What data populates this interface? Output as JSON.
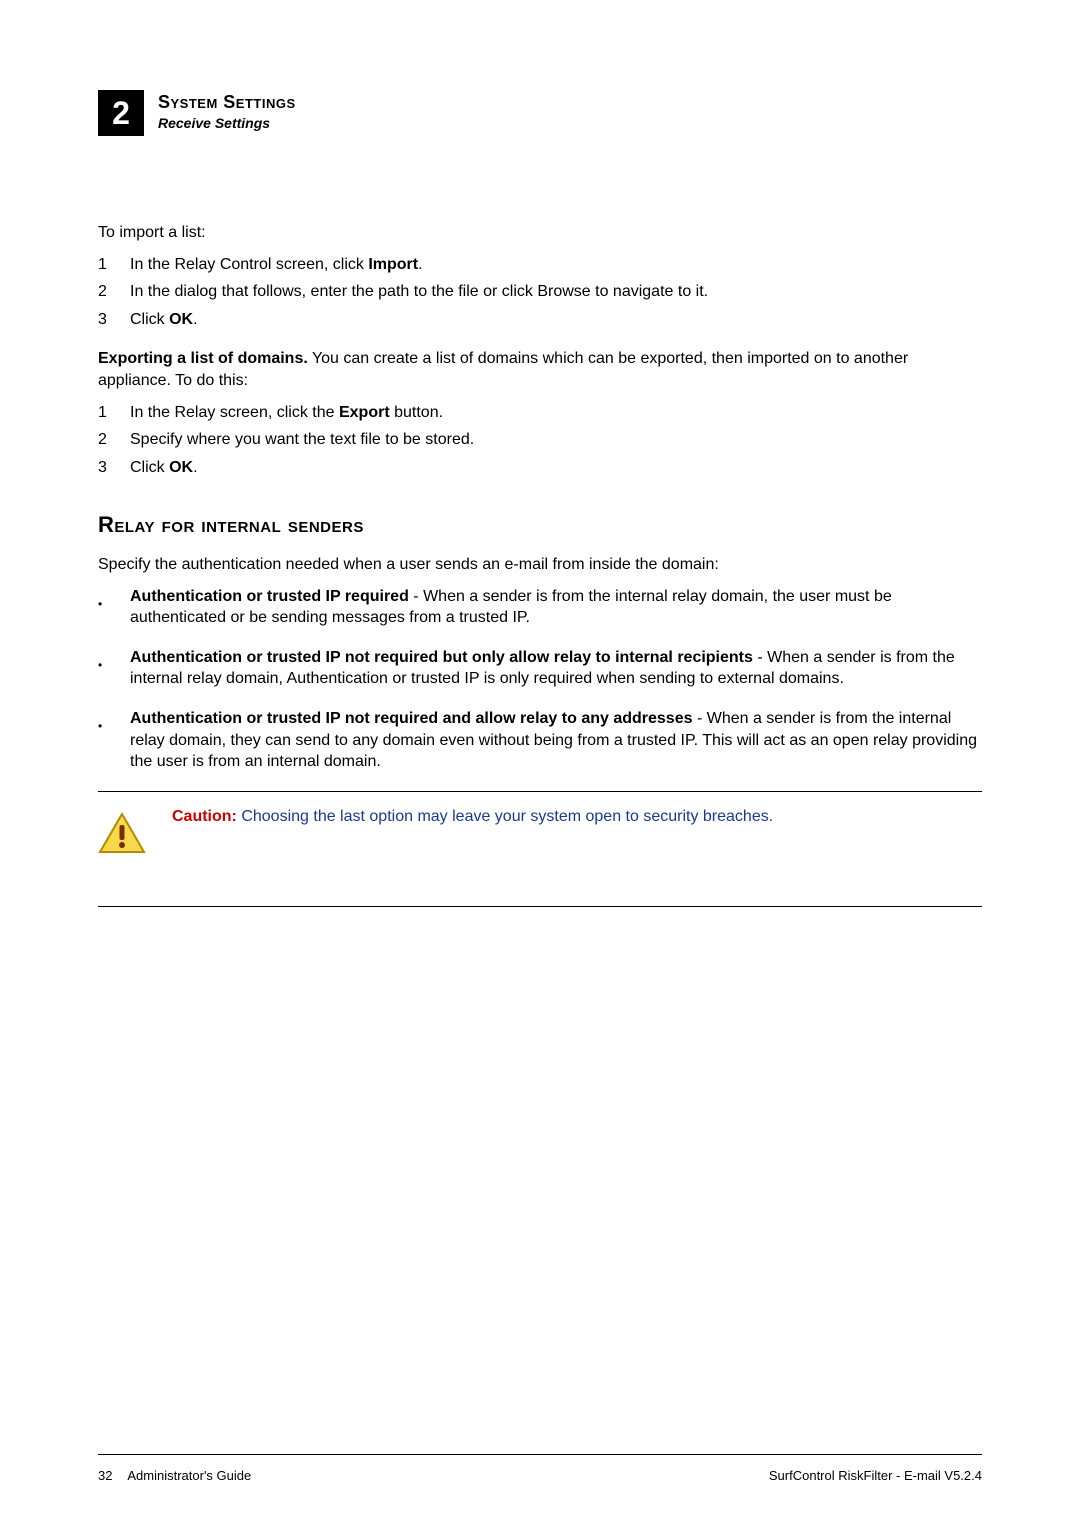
{
  "header": {
    "chapter_number": "2",
    "title": "System Settings",
    "subtitle": "Receive Settings"
  },
  "intro": "To import a list:",
  "import_steps": [
    {
      "n": "1",
      "prefix": "In the Relay Control screen, click ",
      "bold": "Import",
      "suffix": "."
    },
    {
      "n": "2",
      "prefix": "In the dialog that follows, enter the path to the file or click Browse to navigate to it.",
      "bold": "",
      "suffix": ""
    },
    {
      "n": "3",
      "prefix": "Click ",
      "bold": "OK",
      "suffix": "."
    }
  ],
  "export_lead_bold": "Exporting a list of domains.",
  "export_lead_rest": " You can create a list of domains which can be exported, then imported on to another appliance. To do this:",
  "export_steps": [
    {
      "n": "1",
      "prefix": "In the Relay screen, click the ",
      "bold": "Export",
      "suffix": " button."
    },
    {
      "n": "2",
      "prefix": "Specify where you want the text file to be stored.",
      "bold": "",
      "suffix": ""
    },
    {
      "n": "3",
      "prefix": "Click ",
      "bold": "OK",
      "suffix": "."
    }
  ],
  "section_heading": "Relay for internal senders",
  "section_intro": "Specify the authentication needed when a user sends an e-mail from inside the domain:",
  "bullets": [
    {
      "bold": "Authentication or trusted IP required",
      "rest": " - When a sender is from the internal relay domain, the user must be authenticated or be sending messages from a trusted IP."
    },
    {
      "bold": "Authentication or trusted IP not required but only allow relay to internal recipients",
      "rest": " - When a sender is from the internal relay domain, Authentication or trusted IP is only required when sending to external domains."
    },
    {
      "bold": "Authentication or trusted IP not required and allow relay to any addresses",
      "rest": " - When a sender is from the internal relay domain, they can send to any domain even without being from a trusted IP. This will act as an open relay providing the user is from an internal domain."
    }
  ],
  "caution": {
    "label": "Caution:",
    "text": "  Choosing the last option may leave your system open to security breaches."
  },
  "footer": {
    "page": "32",
    "left": "Administrator's Guide",
    "right": "SurfControl RiskFilter - E-mail V5.2.4"
  }
}
